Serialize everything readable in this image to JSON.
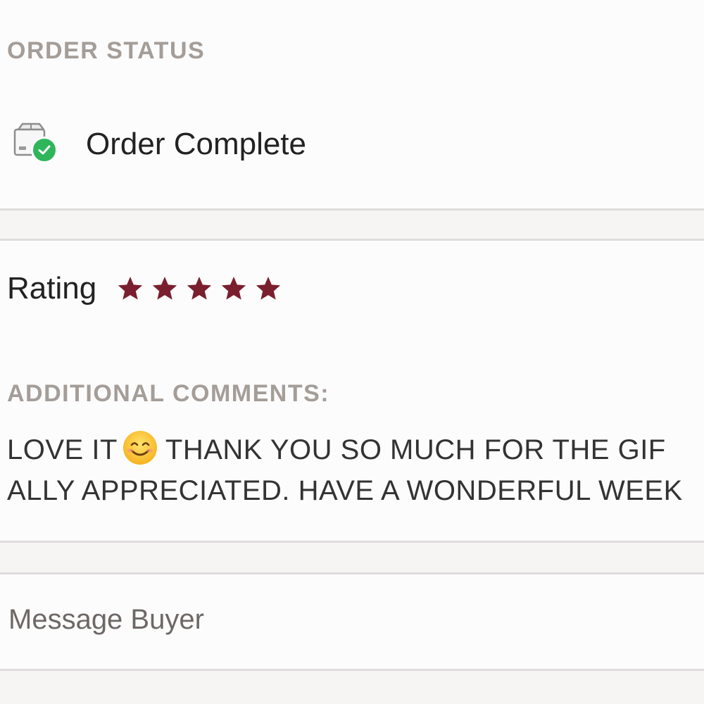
{
  "order_status": {
    "header": "ORDER STATUS",
    "status_text": "Order Complete",
    "icon": "package-check-icon",
    "check_color": "#2fb55a"
  },
  "rating": {
    "label": "Rating",
    "stars": 5,
    "max_stars": 5,
    "star_color": "#7a1f2e"
  },
  "comments": {
    "label": "ADDITIONAL COMMENTS:",
    "line1_part1": "LOVE IT",
    "emoji": "smiling-face-icon",
    "line1_part2": "THANK YOU SO MUCH FOR THE GIF",
    "line2": "ALLY APPRECIATED. HAVE A WONDERFUL WEEK"
  },
  "actions": {
    "message_buyer": "Message Buyer"
  }
}
